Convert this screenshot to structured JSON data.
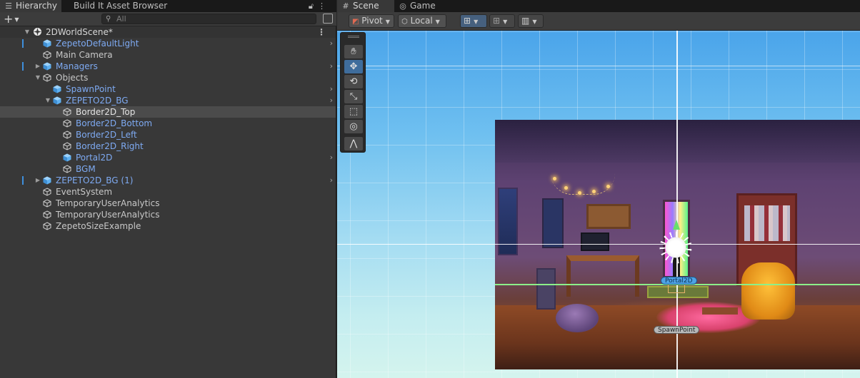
{
  "hierarchy": {
    "tabs": [
      {
        "label": "Hierarchy",
        "icon": "list-icon",
        "active": true
      },
      {
        "label": "Build It Asset Browser",
        "active": false
      }
    ],
    "lock_icon": "lock-icon",
    "menu_icon": "kebab-menu-icon",
    "add_label": "+",
    "search_placeholder": "All",
    "scene_name": "2DWorldScene*",
    "items": [
      {
        "label": "ZepetoDefaultLight",
        "depth": 1,
        "prefab": true,
        "has_chevron": true,
        "has_marker": true
      },
      {
        "label": "Main Camera",
        "depth": 1,
        "prefab": false
      },
      {
        "label": "Managers",
        "depth": 1,
        "prefab": true,
        "collapsed": true,
        "has_chevron": true,
        "has_marker": true
      },
      {
        "label": "Objects",
        "depth": 1,
        "prefab": false,
        "expanded": true
      },
      {
        "label": "SpawnPoint",
        "depth": 2,
        "prefab": true,
        "has_chevron": true
      },
      {
        "label": "ZEPETO2D_BG",
        "depth": 2,
        "prefab": true,
        "expanded": true,
        "has_chevron": true
      },
      {
        "label": "Border2D_Top",
        "depth": 3,
        "prefab": false,
        "selected": true
      },
      {
        "label": "Border2D_Bottom",
        "depth": 3,
        "prefab": false,
        "blue": true
      },
      {
        "label": "Border2D_Left",
        "depth": 3,
        "prefab": false,
        "blue": true
      },
      {
        "label": "Border2D_Right",
        "depth": 3,
        "prefab": false,
        "blue": true
      },
      {
        "label": "Portal2D",
        "depth": 3,
        "prefab": true,
        "has_chevron": true
      },
      {
        "label": "BGM",
        "depth": 3,
        "prefab": false,
        "blue": true
      },
      {
        "label": "ZEPETO2D_BG (1)",
        "depth": 1,
        "prefab": true,
        "collapsed": true,
        "has_chevron": true,
        "has_marker": true
      },
      {
        "label": "EventSystem",
        "depth": 1,
        "prefab": false
      },
      {
        "label": "TemporaryUserAnalytics",
        "depth": 1,
        "prefab": false
      },
      {
        "label": "TemporaryUserAnalytics",
        "depth": 1,
        "prefab": false
      },
      {
        "label": "ZepetoSizeExample",
        "depth": 1,
        "prefab": false
      }
    ]
  },
  "scene": {
    "tabs": [
      {
        "label": "Scene",
        "icon": "hash-icon",
        "active": true
      },
      {
        "label": "Game",
        "icon": "gamepad-icon",
        "active": false
      }
    ],
    "toolbar": {
      "pivot_label": "Pivot",
      "local_label": "Local"
    },
    "tools": [
      "hand-tool",
      "move-tool",
      "rotate-tool",
      "scale-tool",
      "rect-tool",
      "transform-tool",
      "custom-tool"
    ],
    "active_tool": "move-tool",
    "labels": {
      "portal": "Portal2D",
      "spawn": "SpawnPoint"
    }
  },
  "colors": {
    "prefab_blue": "#7eaaf2",
    "selection": "#4b4b4b",
    "axis_green": "#8cf089",
    "active_tool": "#3f6d9c"
  }
}
